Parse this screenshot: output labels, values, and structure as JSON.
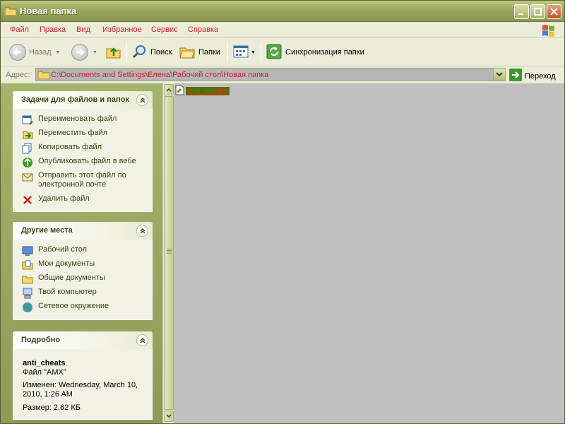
{
  "window": {
    "title": "Новая папка"
  },
  "menu": {
    "items": [
      "Файл",
      "Правка",
      "Вид",
      "Избранное",
      "Сервис",
      "Справка"
    ]
  },
  "toolbar": {
    "back_label": "Назад",
    "search_label": "Поиск",
    "folders_label": "Папки",
    "sync_label": "Синхронизация папки"
  },
  "address": {
    "label": "Адрес:",
    "path": "C:\\Documents and Settings\\Елена\\Рабочий стол\\Новая папка",
    "go_label": "Переход"
  },
  "tasks_panel": {
    "title": "Задачи для файлов и папок",
    "items": [
      {
        "label": "Переименовать файл",
        "icon": "rename-icon"
      },
      {
        "label": "Переместить файл",
        "icon": "move-icon"
      },
      {
        "label": "Копировать файл",
        "icon": "copy-icon"
      },
      {
        "label": "Опубликовать файл в вебе",
        "icon": "publish-web-icon"
      },
      {
        "label": "Отправить этот файл по электронной почте",
        "icon": "email-icon"
      },
      {
        "label": "Удалить файл",
        "icon": "delete-icon"
      }
    ]
  },
  "places_panel": {
    "title": "Другие места",
    "items": [
      {
        "label": "Рабочий стол",
        "icon": "desktop-icon"
      },
      {
        "label": "Мои документы",
        "icon": "my-documents-icon"
      },
      {
        "label": "Общие документы",
        "icon": "shared-documents-icon"
      },
      {
        "label": "Твой компьютер",
        "icon": "my-computer-icon"
      },
      {
        "label": "Сетевое окружение",
        "icon": "network-icon"
      }
    ]
  },
  "details_panel": {
    "title": "Подробно",
    "name": "anti_cheats",
    "type": "Файл \"AMX\"",
    "modified": "Изменен: Wednesday, March 10, 2010, 1:26 AM",
    "size": "Размер: 2.62 КБ"
  },
  "content": {
    "files": [
      {
        "name": "anti_cheats",
        "icon": "file-icon"
      }
    ]
  },
  "colors": {
    "menu_text": "#d0202f",
    "panel_text": "#3a4516",
    "content_bg": "#c0c0c0",
    "selection_bg": "#4f7000"
  }
}
